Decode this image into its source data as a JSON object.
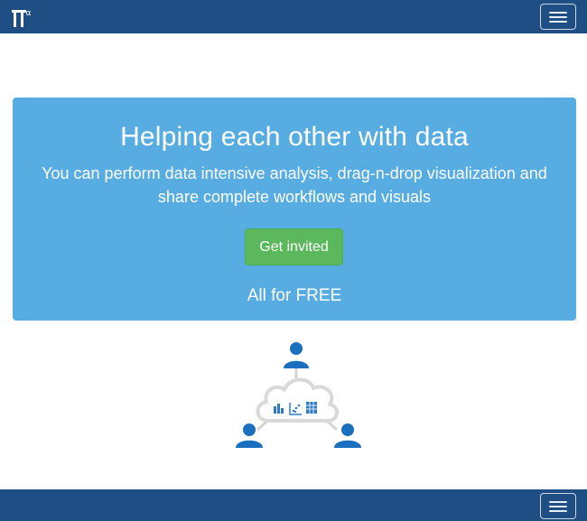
{
  "header": {
    "logo_glyph": "π",
    "logo_superscript": "α",
    "menu_icon": "hamburger-icon"
  },
  "hero": {
    "title": "Helping each other with data",
    "subtitle_line1": "You can perform data intensive analysis, drag-n-drop visualization and",
    "subtitle_line2": "share complete workflows and visuals",
    "cta_label": "Get invited",
    "footer_text": "All for FREE"
  },
  "illustration": {
    "icons": [
      "user-icon",
      "user-icon",
      "user-icon",
      "cloud-icon",
      "bar-chart-icon",
      "scatter-chart-icon",
      "grid-table-icon"
    ]
  },
  "footer_bar": {
    "menu_icon": "hamburger-icon"
  },
  "colors": {
    "navbar": "#1f4e85",
    "hero_bg": "#57ace2",
    "button_green": "#5cb85c",
    "user_blue": "#1a6fbf",
    "cloud_gray": "#d9d9d9"
  }
}
